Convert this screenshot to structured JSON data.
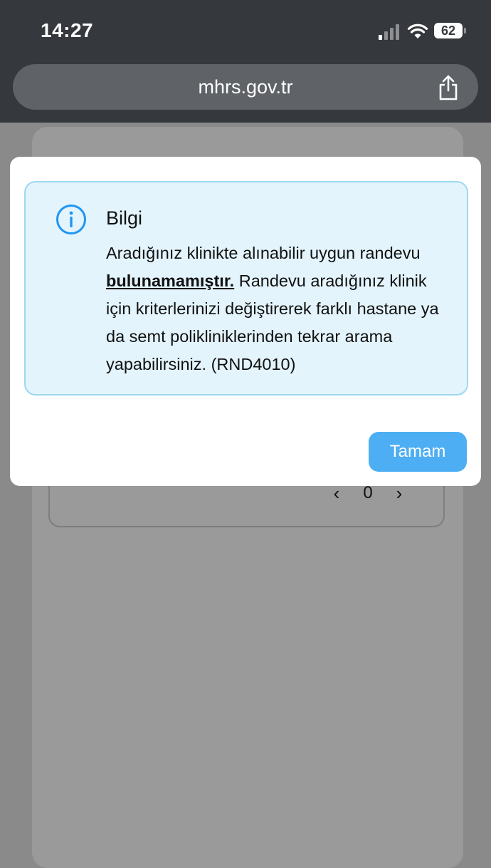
{
  "status_bar": {
    "time": "14:27",
    "battery": "62",
    "icons": [
      "cellular-signal-icon",
      "wifi-icon",
      "battery-icon"
    ]
  },
  "browser": {
    "url": "mhrs.gov.tr",
    "share_icon": "share-icon"
  },
  "background_page": {
    "pager": {
      "prev_icon": "chevron-left-icon",
      "page": "0",
      "next_icon": "chevron-right-icon"
    }
  },
  "dialog": {
    "icon": "info-icon",
    "accent_color": "#2196f3",
    "title": "Bilgi",
    "message_part1": "Aradığınız klinikte alınabilir uygun randevu ",
    "message_strong": "bulunamamıştır.",
    "message_part2": " Randevu aradığınız klinik için kriterlerinizi değiştirerek farklı hastane ya da semt polikliniklerinden tekrar arama yapabilirsiniz. (RND4010)",
    "ok_label": "Tamam",
    "ok_color": "#4eaef3"
  }
}
